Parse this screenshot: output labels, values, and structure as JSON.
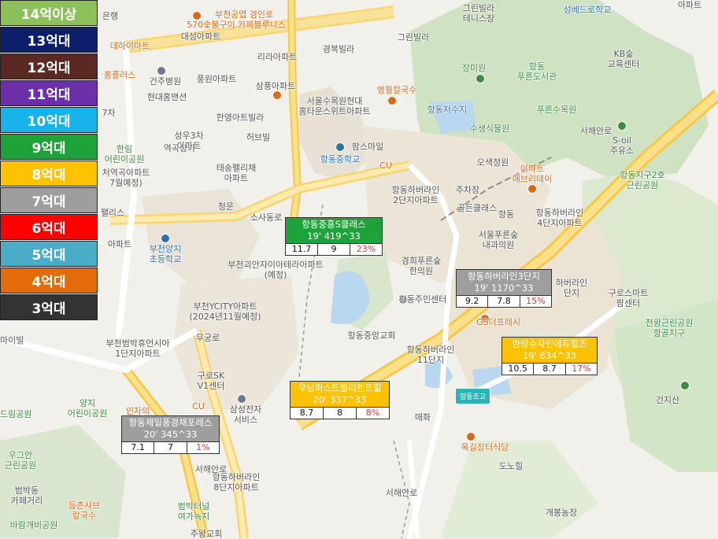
{
  "legend": [
    {
      "label": "14억이상",
      "color": "#8dbf5a",
      "text": "#ffffff"
    },
    {
      "label": "13억대",
      "color": "#0d1f6b",
      "text": "#ffffff"
    },
    {
      "label": "12억대",
      "color": "#5a2a22",
      "text": "#ffffff"
    },
    {
      "label": "11억대",
      "color": "#6b2fa8",
      "text": "#ffffff"
    },
    {
      "label": "10억대",
      "color": "#17b3ea",
      "text": "#ffffff"
    },
    {
      "label": "9억대",
      "color": "#1ea33a",
      "text": "#ffffff"
    },
    {
      "label": "8억대",
      "color": "#ffc200",
      "text": "#ffffff"
    },
    {
      "label": "7억대",
      "color": "#9e9e9e",
      "text": "#ffffff"
    },
    {
      "label": "6억대",
      "color": "#ff0000",
      "text": "#ffffff"
    },
    {
      "label": "5억대",
      "color": "#4bacc6",
      "text": "#ffffff"
    },
    {
      "label": "4억대",
      "color": "#e36c0a",
      "text": "#ffffff"
    },
    {
      "label": "3억대",
      "color": "#333333",
      "text": "#ffffff"
    }
  ],
  "cards": [
    {
      "name": "항동중흥S클래스",
      "info": "19' 419^33",
      "cols": [
        "11.7",
        "9",
        "23%"
      ],
      "color": "#1ea33a"
    },
    {
      "name": "항동하버라인3단지",
      "info": "19' 1170^33",
      "cols": [
        "9.2",
        "7.8",
        "15%"
      ],
      "color": "#9e9e9e"
    },
    {
      "name": "한양수자인에듀힐즈",
      "info": "19' 634^33",
      "cols": [
        "10.5",
        "8.7",
        "17%"
      ],
      "color": "#ffc200"
    },
    {
      "name": "우남퍼스트빌리젠트힐",
      "info": "20' 337^33",
      "cols": [
        "8.7",
        "8",
        "8%"
      ],
      "color": "#ffc200"
    },
    {
      "name": "항동제일풍경채포레스",
      "info": "20' 345^33",
      "cols": [
        "7.1",
        "7",
        "1%"
      ],
      "color": "#9e9e9e"
    }
  ],
  "labels": {
    "l1": "은행",
    "l2": "부천공업 경인로",
    "l3": "570숯불구이 카페블루니스",
    "l4": "대성아파트",
    "l5": "리라아파트",
    "l6": "경복빌라",
    "l7": "그린빌라",
    "l8": "그린빌라\n테니스장",
    "l9": "성베드로학교",
    "l10": "아파트",
    "l11": "데하이마트",
    "l12": "홈플러스",
    "l13": "건주병원",
    "l14": "풍원아파트",
    "l15": "삼풍아파트",
    "l16": "명월칼국수",
    "l17": "현대홈맨션",
    "l18": "서울수목원현대\n홈타운스위트아파트",
    "l19": "장미원",
    "l20": "항동\n푸른도서관",
    "l21": "KB숲\n교육센터",
    "l22": "7차",
    "l23": "한영아트빌라",
    "l24": "성우3차\n아파트",
    "l25": "역곡상가",
    "l26": "허브빌",
    "l27": "항동저수지",
    "l28": "수생식물원",
    "l29": "푸른수목원",
    "l30": "서해안로",
    "l31": "S-oil\n주유소",
    "l32": "한림\n어린이공원",
    "l33": "처역곡아파트\n7월예정)",
    "l34": "태송펠리채\n아파트",
    "l35": "팜스마일",
    "l36": "항동중학교",
    "l37": "오색정원",
    "l38": "이마트\n에브리데이",
    "l39": "항동지구2호\n근린공원",
    "l40": "항동하버라인\n2단지아파트",
    "l41": "주차장",
    "l42": "골든클래스",
    "l43": "항동",
    "l44": "항동하버라인\n4단지아파트",
    "l45": "팰리스",
    "l46": "청운",
    "l47": "소사동로",
    "l48": "부천양지\n초등학교",
    "l49": "아파트",
    "l50": "서울푸른숲\n내과의원",
    "l51": "부천괴안자이아테라아파트\n(예정)",
    "l52": "경희푸른숲\n한의원",
    "l53": "항동주민센터",
    "l54": "하버라인\n단지",
    "l55": "구로스마트\n팜센터",
    "l56": "천왕근린공원\n항골지구",
    "l57": "부천YCITY아파트\n(2024년11월예정)",
    "l58": "GS더프레시",
    "l59": "마이빌",
    "l60": "부천범박휴먼시아\n1단지아파트",
    "l61": "항동중앙교회",
    "l62": "항동하버라인\n11단지",
    "l63": "무궁로",
    "l64": "구로SK\nV1센터",
    "l65": "양지\n어린이공원",
    "l66": "인자의",
    "l67": "삼성전자\n서비스",
    "l68": "매화",
    "l69": "항동초교",
    "l70": "건지산",
    "l71": "드림공원",
    "l72": "옥길장터식당",
    "l73": "도노힐",
    "l74": "우그안\n근린공원",
    "l75": "범박동\n카페거리",
    "l76": "등촌샤브\n칼국수",
    "l77": "항동하버라인\n8단지아파트",
    "l78": "범박터널\n여가녹지",
    "l79": "개봉농장",
    "l80": "바람개비공원",
    "l81": "서해안로",
    "l82": "서해안로",
    "l83": "CU",
    "l84": "CU",
    "l85": "주왕교회"
  }
}
